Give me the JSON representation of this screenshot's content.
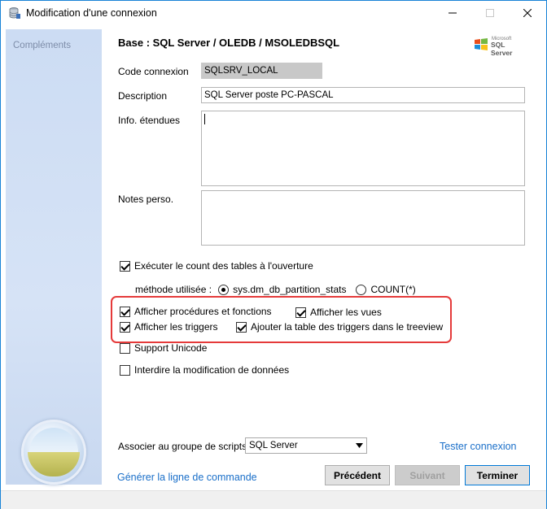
{
  "window": {
    "title": "Modification d'une connexion"
  },
  "sidebar": {
    "title": "Compléments"
  },
  "header": {
    "title": "Base : SQL Server / OLEDB / MSOLEDBSQL",
    "logo_small": "Microsoft",
    "logo_text": "SQL Server"
  },
  "form": {
    "code_label": "Code connexion",
    "code_value": "SQLSRV_LOCAL",
    "description_label": "Description",
    "description_value": "SQL Server poste PC-PASCAL",
    "info_label": "Info. étendues",
    "info_value": "",
    "notes_label": "Notes perso.",
    "notes_value": ""
  },
  "options": {
    "count_label": "Exécuter le count des tables à l'ouverture",
    "count_checked": true,
    "method_label": "méthode utilisée :",
    "method_option1": "sys.dm_db_partition_stats",
    "method_option2": "COUNT(*)",
    "method_selected": "sys.dm_db_partition_stats",
    "show_procs_label": "Afficher procédures et fonctions",
    "show_procs_checked": true,
    "show_views_label": "Afficher les vues",
    "show_views_checked": true,
    "show_triggers_label": "Afficher les triggers",
    "show_triggers_checked": true,
    "add_triggers_table_label": "Ajouter la table des triggers dans le treeview",
    "add_triggers_table_checked": true,
    "unicode_label": "Support Unicode",
    "unicode_checked": false,
    "forbid_edit_label": "Interdire la modification de données",
    "forbid_edit_checked": false
  },
  "scripts": {
    "group_label": "Associer au groupe de scripts",
    "group_value": "SQL Server",
    "test_link": "Tester connexion"
  },
  "footer": {
    "generate_link": "Générer la ligne de commande",
    "prev_button": "Précédent",
    "next_button": "Suivant",
    "finish_button": "Terminer"
  },
  "colors": {
    "accent": "#0078d7",
    "link": "#1a6fc9",
    "highlight": "#e53a3a"
  }
}
